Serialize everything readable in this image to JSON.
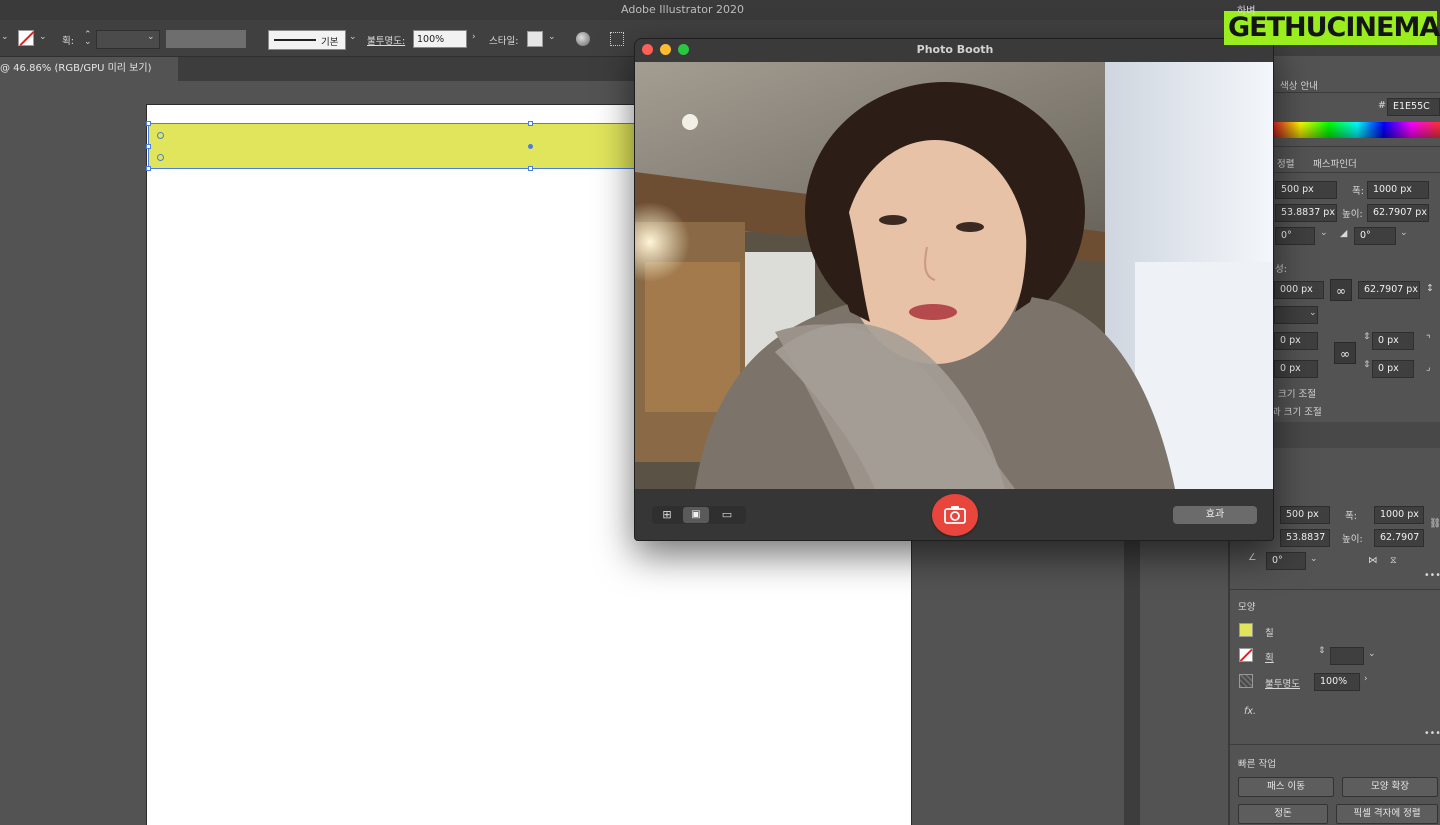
{
  "app": {
    "title": "Adobe Illustrator 2020"
  },
  "toolbar": {
    "stroke_label": "획:",
    "stroke_profile": "기본",
    "opacity_label": "불투명도:",
    "opacity_value": "100%",
    "style_label": "스타일:"
  },
  "document": {
    "tab_label": "@ 46.86% (RGB/GPU 미리 보기)"
  },
  "photobooth": {
    "title": "Photo Booth",
    "effects_label": "효과"
  },
  "panel": {
    "top_label": "하벼",
    "color_guide_tab": "색상 안내",
    "hex_value": "E1E55C",
    "align_tab": "정렬",
    "pathfinder_tab": "패스파인더",
    "x_value": "500 px",
    "w_label": "폭:",
    "w_value": "1000 px",
    "y_value": "53.8837 px",
    "h_label": "높이:",
    "h_value": "62.7907 px",
    "rotate_value": "0°",
    "shear_value": "0°",
    "props_label": "성:",
    "lw_value": "000 px",
    "lh_value": "62.7907 px",
    "offset_a": "0 px",
    "offset_b": "0 px",
    "offset_c": "0 px",
    "offset_d": "0 px",
    "scale_text_1": "크기 조절",
    "scale_text_2": "과 크기 조절",
    "transform": {
      "x_value": "500 px",
      "w_label": "폭:",
      "w_value": "1000 px",
      "y_value": "53.8837",
      "h_label": "높이:",
      "h_value": "62.7907",
      "angle_value": "0°"
    },
    "appearance": {
      "title": "모양",
      "fill_label": "칠",
      "stroke_label": "획",
      "opacity_label": "불투명도",
      "opacity_value": "100%",
      "fx_label": "fx."
    },
    "quick_actions": {
      "title": "빠른 작업",
      "path_move": "패스 이동",
      "expand": "모양 확장",
      "arrange": "정돈",
      "pixel_align": "픽셀 격자에 정렬"
    }
  },
  "watermark": {
    "text": "GETHUCINEMA"
  },
  "colors": {
    "fill": "#e1e55c",
    "accent": "#4a7de0",
    "shutter": "#e8453c"
  }
}
